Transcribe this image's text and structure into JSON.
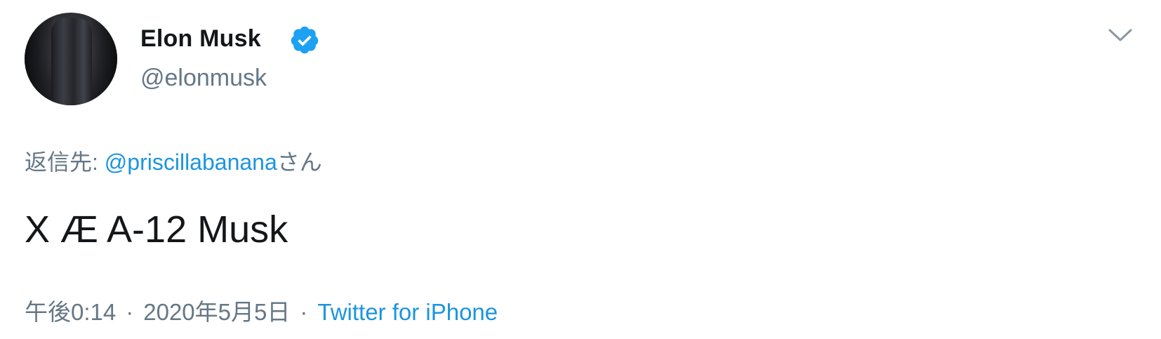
{
  "author": {
    "name": "Elon Musk",
    "handle": "@elonmusk",
    "verified": true
  },
  "reply": {
    "prefix": "返信先: ",
    "mention": "@priscillabanana",
    "suffix": "さん"
  },
  "tweet": {
    "text": "X Æ A-12 Musk"
  },
  "meta": {
    "time": "午後0:14",
    "separator": "·",
    "date": "2020年5月5日",
    "source": "Twitter for iPhone"
  },
  "icons": {
    "verified": "verified-badge-icon",
    "menu": "chevron-down-icon"
  },
  "colors": {
    "link": "#1b95e0",
    "secondary_text": "#657786",
    "primary_text": "#14171a",
    "verified": "#1da1f2"
  }
}
